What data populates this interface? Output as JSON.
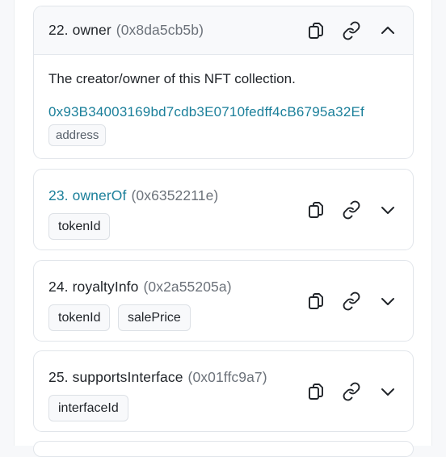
{
  "functions": [
    {
      "number": "22.",
      "name": "owner",
      "selector": "(0x8da5cb5b)",
      "expanded": true,
      "description": "The creator/owner of this NFT collection.",
      "value": "0x93B34003169bd7cdb3E0710fedff4cB6795a32Ef",
      "value_type": "address",
      "toggle_icon": "chevron-up-icon"
    },
    {
      "number": "23.",
      "name": "ownerOf",
      "selector": "(0x6352211e)",
      "expanded": false,
      "params": [
        "tokenId"
      ],
      "toggle_icon": "chevron-down-icon"
    },
    {
      "number": "24.",
      "name": "royaltyInfo",
      "selector": "(0x2a55205a)",
      "expanded": false,
      "params": [
        "tokenId",
        "salePrice"
      ],
      "toggle_icon": "chevron-down-icon"
    },
    {
      "number": "25.",
      "name": "supportsInterface",
      "selector": "(0x01ffc9a7)",
      "expanded": false,
      "params": [
        "interfaceId"
      ],
      "toggle_icon": "chevron-down-icon"
    }
  ],
  "colors": {
    "link": "#1a7f9a",
    "muted": "#6c727a",
    "border": "#e1e5ea"
  }
}
